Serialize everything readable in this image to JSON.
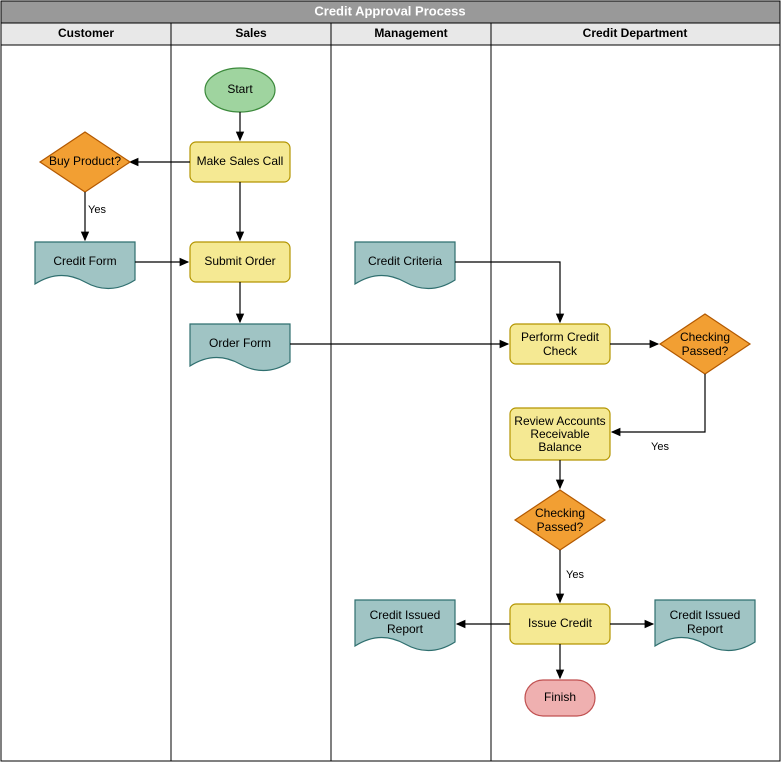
{
  "title": "Credit Approval Process",
  "lanes": {
    "customer": "Customer",
    "sales": "Sales",
    "management": "Management",
    "credit": "Credit Department"
  },
  "nodes": {
    "start": "Start",
    "make_sales_call": "Make Sales Call",
    "buy_product": "Buy Product?",
    "credit_form": "Credit Form",
    "submit_order": "Submit Order",
    "order_form": "Order Form",
    "credit_criteria": "Credit Criteria",
    "perform_credit_check_l1": "Perform Credit",
    "perform_credit_check_l2": "Check",
    "checking_passed_1_l1": "Checking",
    "checking_passed_1_l2": "Passed?",
    "review_ar_l1": "Review Accounts",
    "review_ar_l2": "Receivable",
    "review_ar_l3": "Balance",
    "checking_passed_2_l1": "Checking",
    "checking_passed_2_l2": "Passed?",
    "issue_credit": "Issue Credit",
    "credit_issued_report_1_l1": "Credit Issued",
    "credit_issued_report_1_l2": "Report",
    "credit_issued_report_2_l1": "Credit Issued",
    "credit_issued_report_2_l2": "Report",
    "finish": "Finish"
  },
  "edge_labels": {
    "yes1": "Yes",
    "yes2": "Yes",
    "yes3": "Yes"
  }
}
